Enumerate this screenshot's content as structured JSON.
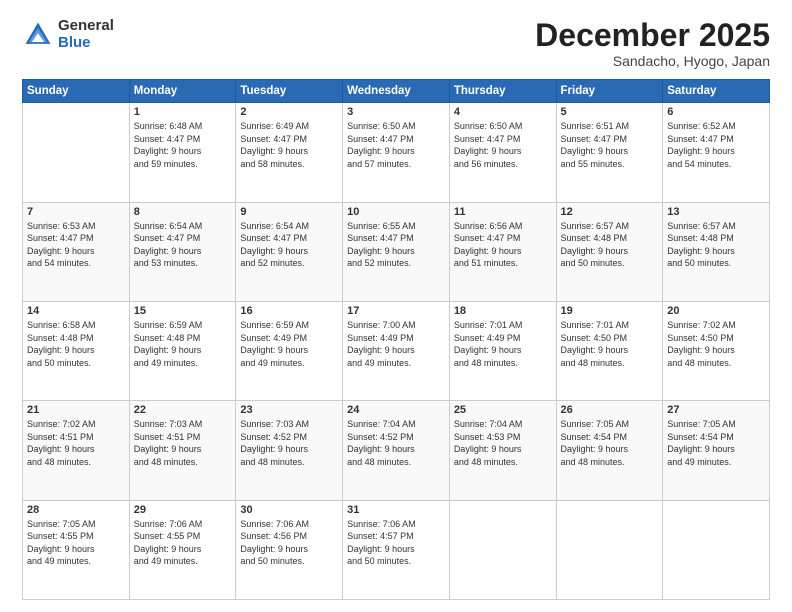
{
  "logo": {
    "general": "General",
    "blue": "Blue"
  },
  "header": {
    "month": "December 2025",
    "location": "Sandacho, Hyogo, Japan"
  },
  "days_of_week": [
    "Sunday",
    "Monday",
    "Tuesday",
    "Wednesday",
    "Thursday",
    "Friday",
    "Saturday"
  ],
  "weeks": [
    [
      {
        "day": "",
        "info": ""
      },
      {
        "day": "1",
        "info": "Sunrise: 6:48 AM\nSunset: 4:47 PM\nDaylight: 9 hours\nand 59 minutes."
      },
      {
        "day": "2",
        "info": "Sunrise: 6:49 AM\nSunset: 4:47 PM\nDaylight: 9 hours\nand 58 minutes."
      },
      {
        "day": "3",
        "info": "Sunrise: 6:50 AM\nSunset: 4:47 PM\nDaylight: 9 hours\nand 57 minutes."
      },
      {
        "day": "4",
        "info": "Sunrise: 6:50 AM\nSunset: 4:47 PM\nDaylight: 9 hours\nand 56 minutes."
      },
      {
        "day": "5",
        "info": "Sunrise: 6:51 AM\nSunset: 4:47 PM\nDaylight: 9 hours\nand 55 minutes."
      },
      {
        "day": "6",
        "info": "Sunrise: 6:52 AM\nSunset: 4:47 PM\nDaylight: 9 hours\nand 54 minutes."
      }
    ],
    [
      {
        "day": "7",
        "info": "Sunrise: 6:53 AM\nSunset: 4:47 PM\nDaylight: 9 hours\nand 54 minutes."
      },
      {
        "day": "8",
        "info": "Sunrise: 6:54 AM\nSunset: 4:47 PM\nDaylight: 9 hours\nand 53 minutes."
      },
      {
        "day": "9",
        "info": "Sunrise: 6:54 AM\nSunset: 4:47 PM\nDaylight: 9 hours\nand 52 minutes."
      },
      {
        "day": "10",
        "info": "Sunrise: 6:55 AM\nSunset: 4:47 PM\nDaylight: 9 hours\nand 52 minutes."
      },
      {
        "day": "11",
        "info": "Sunrise: 6:56 AM\nSunset: 4:47 PM\nDaylight: 9 hours\nand 51 minutes."
      },
      {
        "day": "12",
        "info": "Sunrise: 6:57 AM\nSunset: 4:48 PM\nDaylight: 9 hours\nand 50 minutes."
      },
      {
        "day": "13",
        "info": "Sunrise: 6:57 AM\nSunset: 4:48 PM\nDaylight: 9 hours\nand 50 minutes."
      }
    ],
    [
      {
        "day": "14",
        "info": "Sunrise: 6:58 AM\nSunset: 4:48 PM\nDaylight: 9 hours\nand 50 minutes."
      },
      {
        "day": "15",
        "info": "Sunrise: 6:59 AM\nSunset: 4:48 PM\nDaylight: 9 hours\nand 49 minutes."
      },
      {
        "day": "16",
        "info": "Sunrise: 6:59 AM\nSunset: 4:49 PM\nDaylight: 9 hours\nand 49 minutes."
      },
      {
        "day": "17",
        "info": "Sunrise: 7:00 AM\nSunset: 4:49 PM\nDaylight: 9 hours\nand 49 minutes."
      },
      {
        "day": "18",
        "info": "Sunrise: 7:01 AM\nSunset: 4:49 PM\nDaylight: 9 hours\nand 48 minutes."
      },
      {
        "day": "19",
        "info": "Sunrise: 7:01 AM\nSunset: 4:50 PM\nDaylight: 9 hours\nand 48 minutes."
      },
      {
        "day": "20",
        "info": "Sunrise: 7:02 AM\nSunset: 4:50 PM\nDaylight: 9 hours\nand 48 minutes."
      }
    ],
    [
      {
        "day": "21",
        "info": "Sunrise: 7:02 AM\nSunset: 4:51 PM\nDaylight: 9 hours\nand 48 minutes."
      },
      {
        "day": "22",
        "info": "Sunrise: 7:03 AM\nSunset: 4:51 PM\nDaylight: 9 hours\nand 48 minutes."
      },
      {
        "day": "23",
        "info": "Sunrise: 7:03 AM\nSunset: 4:52 PM\nDaylight: 9 hours\nand 48 minutes."
      },
      {
        "day": "24",
        "info": "Sunrise: 7:04 AM\nSunset: 4:52 PM\nDaylight: 9 hours\nand 48 minutes."
      },
      {
        "day": "25",
        "info": "Sunrise: 7:04 AM\nSunset: 4:53 PM\nDaylight: 9 hours\nand 48 minutes."
      },
      {
        "day": "26",
        "info": "Sunrise: 7:05 AM\nSunset: 4:54 PM\nDaylight: 9 hours\nand 48 minutes."
      },
      {
        "day": "27",
        "info": "Sunrise: 7:05 AM\nSunset: 4:54 PM\nDaylight: 9 hours\nand 49 minutes."
      }
    ],
    [
      {
        "day": "28",
        "info": "Sunrise: 7:05 AM\nSunset: 4:55 PM\nDaylight: 9 hours\nand 49 minutes."
      },
      {
        "day": "29",
        "info": "Sunrise: 7:06 AM\nSunset: 4:55 PM\nDaylight: 9 hours\nand 49 minutes."
      },
      {
        "day": "30",
        "info": "Sunrise: 7:06 AM\nSunset: 4:56 PM\nDaylight: 9 hours\nand 50 minutes."
      },
      {
        "day": "31",
        "info": "Sunrise: 7:06 AM\nSunset: 4:57 PM\nDaylight: 9 hours\nand 50 minutes."
      },
      {
        "day": "",
        "info": ""
      },
      {
        "day": "",
        "info": ""
      },
      {
        "day": "",
        "info": ""
      }
    ]
  ]
}
